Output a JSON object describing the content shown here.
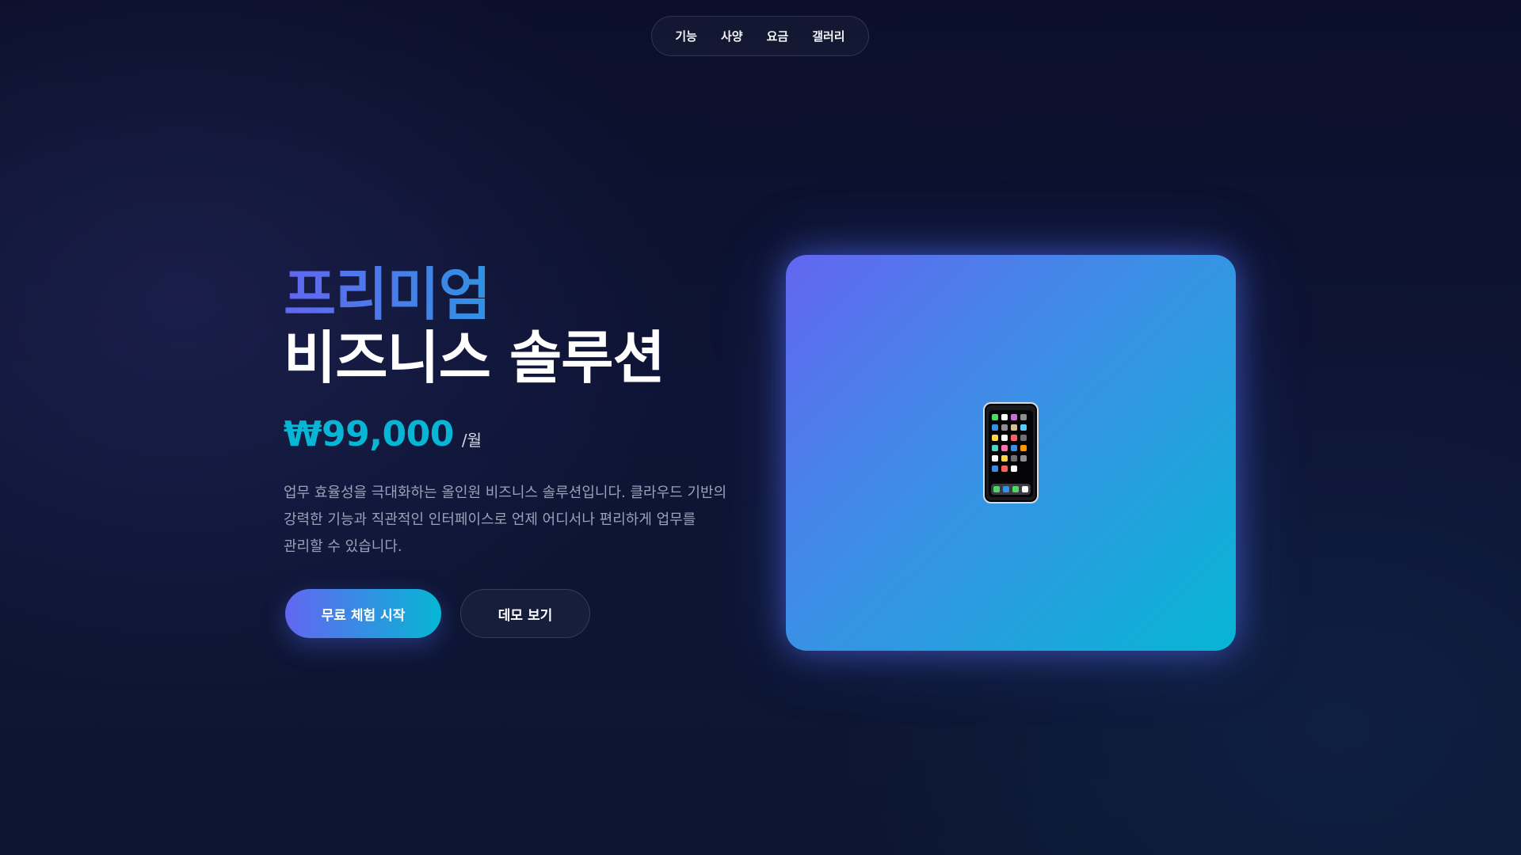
{
  "nav": {
    "items": [
      {
        "label": "기능"
      },
      {
        "label": "사양"
      },
      {
        "label": "요금"
      },
      {
        "label": "갤러리"
      }
    ]
  },
  "hero": {
    "title_accent": "프리미엄",
    "title_main": "비즈니스 솔루션",
    "price": "₩99,000",
    "price_unit": "/월",
    "description": "업무 효율성을 극대화하는 올인원 비즈니스 솔루션입니다. 클라우드 기반의 강력한 기능과 직관적인 인터페이스로 언제 어디서나 편리하게 업무를 관리할 수 있습니다.",
    "primary_button": "무료 체험 시작",
    "secondary_button": "데모 보기"
  },
  "visual": {
    "icon": "mobile-phone-icon"
  },
  "colors": {
    "background": "#0e1435",
    "accent_start": "#6366f1",
    "accent_end": "#06b6d4",
    "price": "#06b6d4",
    "description": "#9aa2b8"
  }
}
